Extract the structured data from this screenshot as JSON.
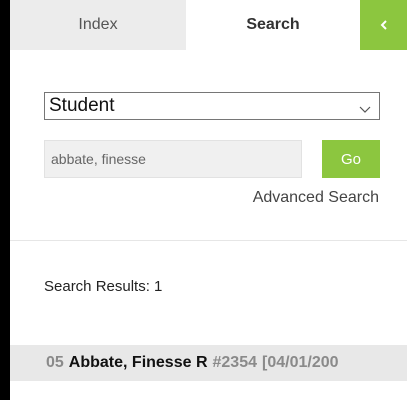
{
  "tabs": {
    "index_label": "Index",
    "search_label": "Search",
    "collapse_glyph": "<"
  },
  "search": {
    "type_selected": "Student",
    "query_value": "abbate, finesse",
    "go_label": "Go",
    "advanced_label": "Advanced Search"
  },
  "results": {
    "count_label": "Search Results: 1",
    "items": [
      {
        "grade": "05",
        "name": "Abbate, Finesse R",
        "id": "#2354",
        "date": "[04/01/200"
      }
    ]
  },
  "colors": {
    "accent": "#8cc63f",
    "tab_inactive": "#ececec",
    "row_background": "#e8e8e8"
  },
  "icons": {
    "collapse": "chevron-left-icon",
    "select_arrow": "chevron-down-icon"
  }
}
